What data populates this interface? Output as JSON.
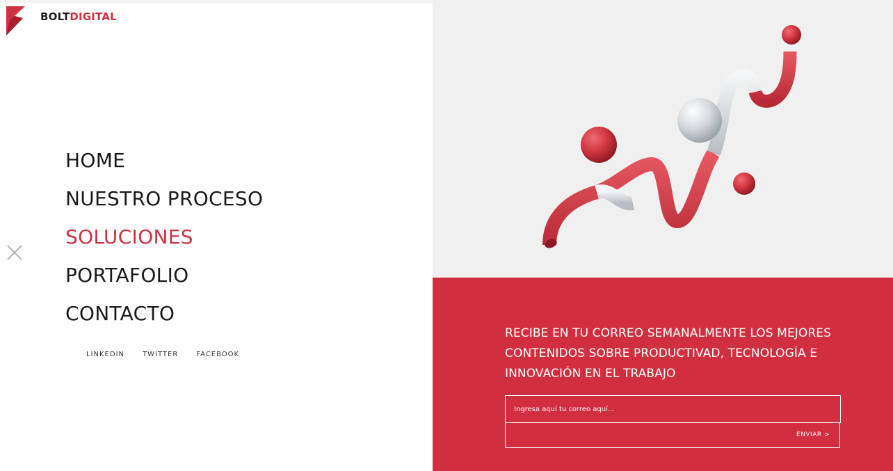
{
  "brand": {
    "part1": "BOLT",
    "part2": "DIGITAL"
  },
  "menu": {
    "items": [
      {
        "label": "HOME",
        "active": false
      },
      {
        "label": "NUESTRO PROCESO",
        "active": false
      },
      {
        "label": "SOLUCIONES",
        "active": true
      },
      {
        "label": "PORTAFOLIO",
        "active": false
      },
      {
        "label": "CONTACTO",
        "active": false
      }
    ],
    "close_icon": "close-icon"
  },
  "social": {
    "links": [
      "LINKEDIN",
      "TWITTER",
      "FACEBOOK"
    ]
  },
  "newsletter": {
    "heading": "RECIBE EN TU CORREO SEMANALMENTE LOS MEJORES CONTENIDOS SOBRE PRODUCTIVAD, TECNOLOGÍA E INNOVACIÓN EN EL TRABAJO",
    "email_placeholder": "Ingresa aquí tu correo aquí...",
    "email_value": "",
    "submit_label": "ENVIAR >"
  },
  "colors": {
    "accent": "#d12f40",
    "text": "#1a1a1a",
    "panel": "#f0f0f0",
    "art_grey": "#d6d9dc"
  }
}
